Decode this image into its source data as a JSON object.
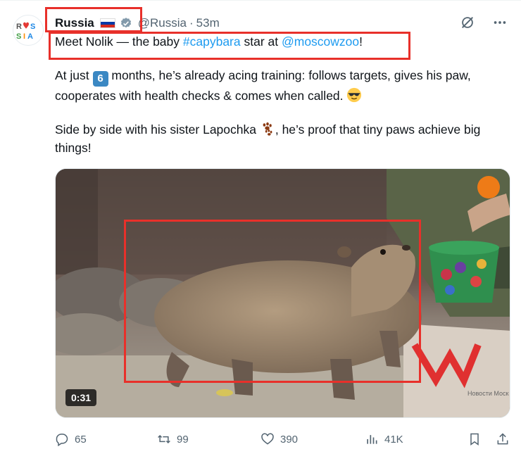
{
  "author": {
    "display_name": "Russia",
    "handle": "@Russia",
    "separator": "·",
    "time": "53m",
    "avatar_text": [
      "RUS",
      "SIA"
    ]
  },
  "tweet": {
    "line1_prefix": "Meet Nolik — the baby ",
    "hashtag": "#capybara",
    "line1_middle": " star at ",
    "mention": "@moscowzoo",
    "line1_suffix": "!",
    "p2_prefix": "At just ",
    "p2_number_emoji": "6",
    "p2_text": " months, he’s already acing training: follows targets, gives his paw, cooperates with health checks & comes when called. ",
    "p3_text": "Side by side with his sister Lapochka ",
    "p3_after": ", he’s proof that tiny paws achieve big things!"
  },
  "media": {
    "duration": "0:31",
    "overlay_text": "Новости Моск"
  },
  "footer": {
    "replies": "65",
    "reposts": "99",
    "likes": "390",
    "views": "41K"
  },
  "colors": {
    "link": "#1d9bf0",
    "annotation_box": "#e8302a",
    "muted": "#536471"
  },
  "icons": {
    "top_actions": [
      "grok-icon",
      "more-icon"
    ],
    "footer": [
      "reply-icon",
      "repost-icon",
      "like-icon",
      "views-icon",
      "bookmark-icon",
      "share-icon"
    ]
  }
}
